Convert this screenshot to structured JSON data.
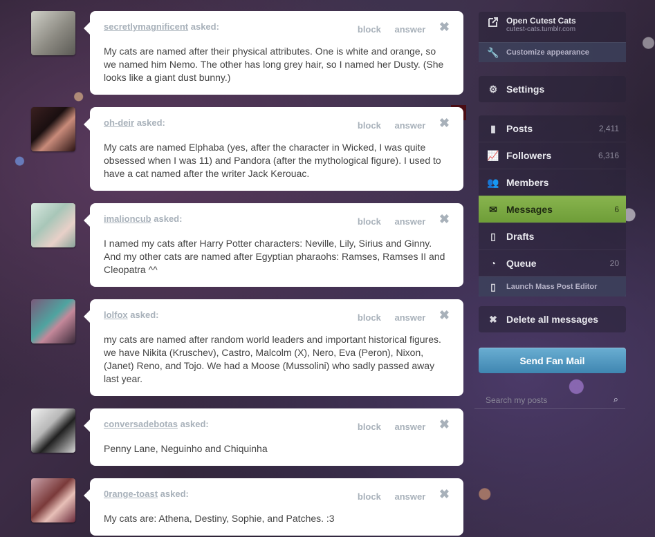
{
  "labels": {
    "asked": "asked:",
    "block": "block",
    "answer": "answer",
    "close": "✖"
  },
  "posts": [
    {
      "asker": "secretlymagnificent",
      "text": "My cats are named after their physical attributes. One is white and orange, so we named him Nemo. The other has long grey hair, so I named her Dusty. (She looks like a giant dust bunny.)"
    },
    {
      "asker": "oh-deir",
      "text": "My cats are named Elphaba (yes, after the character in Wicked, I was quite obsessed when I was 11) and Pandora (after the mythological figure). I used to have a cat named after the writer Jack Kerouac."
    },
    {
      "asker": "imalioncub",
      "text": "I named my cats after Harry Potter characters: Neville, Lily, Sirius and Ginny. And my other cats are named after Egyptian pharaohs: Ramses, Ramses II and Cleopatra ^^"
    },
    {
      "asker": "lolfox",
      "text": "my cats are named after random world leaders and important historical figures. we have Nikita (Kruschev), Castro, Malcolm (X), Nero, Eva (Peron), Nixon, (Janet) Reno, and Tojo. We had a Moose (Mussolini) who sadly passed away last year."
    },
    {
      "asker": "conversadebotas",
      "text": "Penny Lane, Neguinho and Chiquinha"
    },
    {
      "asker": "0range-toast",
      "text": "My cats are: Athena, Destiny, Sophie, and Patches. :3"
    }
  ],
  "sidebar": {
    "blog_title": "Open Cutest Cats",
    "blog_url": "cutest-cats.tumblr.com",
    "customize": "Customize appearance",
    "settings": "Settings",
    "nav": [
      {
        "label": "Posts",
        "count": "2,411",
        "icon": "page-icon"
      },
      {
        "label": "Followers",
        "count": "6,316",
        "icon": "chart-icon"
      },
      {
        "label": "Members",
        "count": "",
        "icon": "people-icon"
      },
      {
        "label": "Messages",
        "count": "6",
        "icon": "envelope-icon"
      },
      {
        "label": "Drafts",
        "count": "",
        "icon": "page-icon"
      },
      {
        "label": "Queue",
        "count": "20",
        "icon": "clock-icon"
      }
    ],
    "mass_editor": "Launch Mass Post Editor",
    "delete_all": "Delete all messages",
    "fan_mail": "Send Fan Mail",
    "search_placeholder": "Search my posts"
  }
}
